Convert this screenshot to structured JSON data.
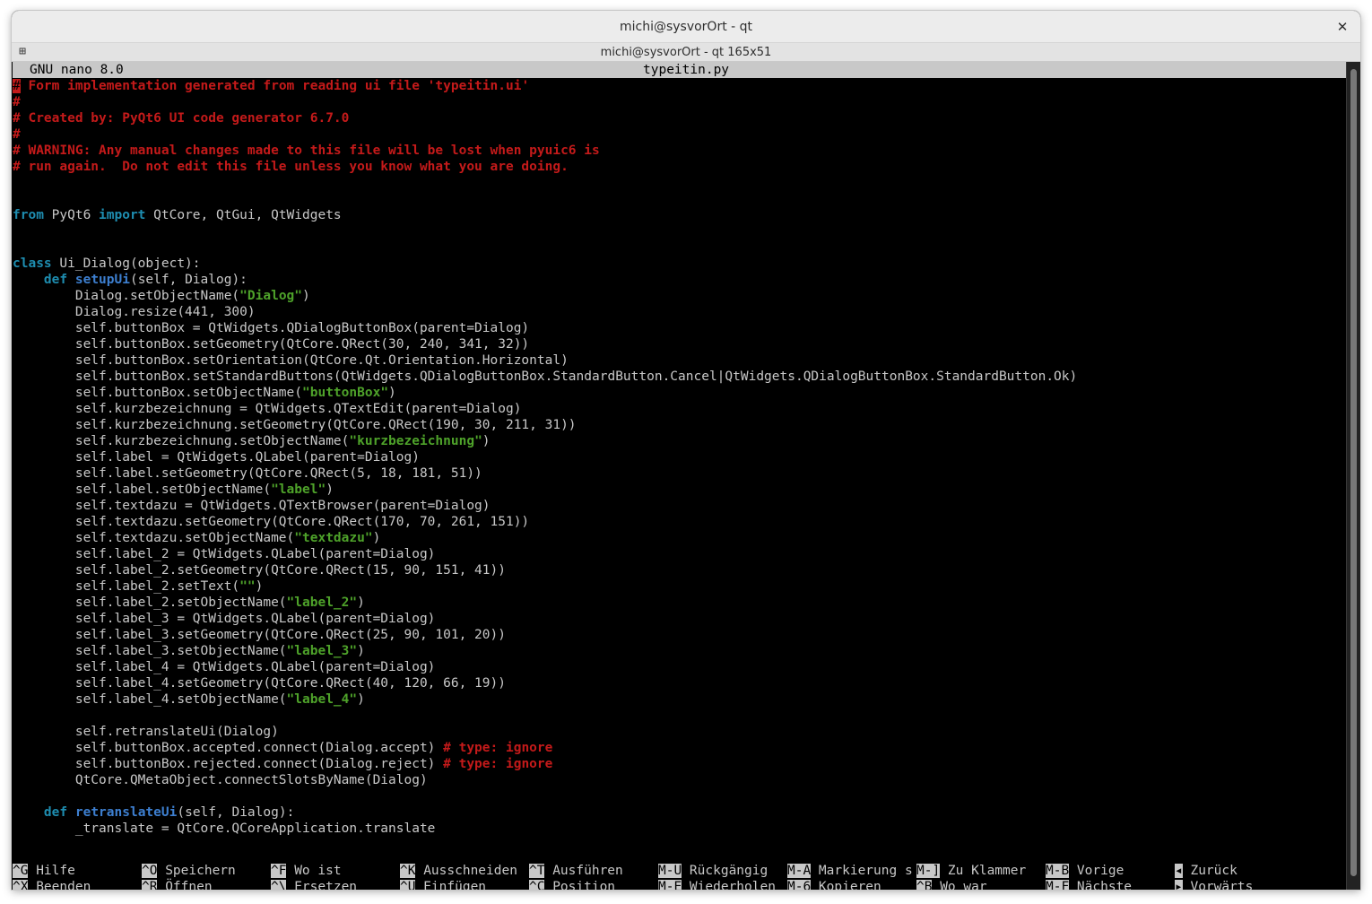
{
  "window": {
    "title": "michi@sysvorOrt - qt",
    "tab_title": "michi@sysvorOrt - qt 165x51",
    "close_glyph": "✕",
    "menu_glyph": "⊞"
  },
  "nano": {
    "version": "GNU nano 8.0",
    "filename": "typeitin.py"
  },
  "code_lines": [
    [
      {
        "t": "#",
        "c": "cursor"
      },
      {
        "t": " Form implementation generated from reading ui file 'typeitin.ui'",
        "c": "cm"
      }
    ],
    [
      {
        "t": "#",
        "c": "cm"
      }
    ],
    [
      {
        "t": "# Created by: PyQt6 UI code generator 6.7.0",
        "c": "cm"
      }
    ],
    [
      {
        "t": "#",
        "c": "cm"
      }
    ],
    [
      {
        "t": "# WARNING: Any manual changes made to this file will be lost when pyuic6 is",
        "c": "cm"
      }
    ],
    [
      {
        "t": "# run again.  Do not edit this file unless you know what you are doing.",
        "c": "cm"
      }
    ],
    [],
    [],
    [
      {
        "t": "from",
        "c": "kw"
      },
      {
        "t": " PyQt6 ",
        "c": "ident"
      },
      {
        "t": "import",
        "c": "kw"
      },
      {
        "t": " QtCore, QtGui, QtWidgets",
        "c": "ident"
      }
    ],
    [],
    [],
    [
      {
        "t": "class",
        "c": "kw"
      },
      {
        "t": " Ui_Dialog(object):",
        "c": "ident"
      }
    ],
    [
      {
        "t": "    ",
        "c": "ident"
      },
      {
        "t": "def",
        "c": "kw"
      },
      {
        "t": " ",
        "c": "ident"
      },
      {
        "t": "setupUi",
        "c": "fn"
      },
      {
        "t": "(self, Dialog):",
        "c": "ident"
      }
    ],
    [
      {
        "t": "        Dialog.setObjectName(",
        "c": "ident"
      },
      {
        "t": "\"Dialog\"",
        "c": "st"
      },
      {
        "t": ")",
        "c": "ident"
      }
    ],
    [
      {
        "t": "        Dialog.resize(441, 300)",
        "c": "ident"
      }
    ],
    [
      {
        "t": "        self.buttonBox = QtWidgets.QDialogButtonBox(parent=Dialog)",
        "c": "ident"
      }
    ],
    [
      {
        "t": "        self.buttonBox.setGeometry(QtCore.QRect(30, 240, 341, 32))",
        "c": "ident"
      }
    ],
    [
      {
        "t": "        self.buttonBox.setOrientation(QtCore.Qt.Orientation.Horizontal)",
        "c": "ident"
      }
    ],
    [
      {
        "t": "        self.buttonBox.setStandardButtons(QtWidgets.QDialogButtonBox.StandardButton.Cancel|QtWidgets.QDialogButtonBox.StandardButton.Ok)",
        "c": "ident"
      }
    ],
    [
      {
        "t": "        self.buttonBox.setObjectName(",
        "c": "ident"
      },
      {
        "t": "\"buttonBox\"",
        "c": "st"
      },
      {
        "t": ")",
        "c": "ident"
      }
    ],
    [
      {
        "t": "        self.kurzbezeichnung = QtWidgets.QTextEdit(parent=Dialog)",
        "c": "ident"
      }
    ],
    [
      {
        "t": "        self.kurzbezeichnung.setGeometry(QtCore.QRect(190, 30, 211, 31))",
        "c": "ident"
      }
    ],
    [
      {
        "t": "        self.kurzbezeichnung.setObjectName(",
        "c": "ident"
      },
      {
        "t": "\"kurzbezeichnung\"",
        "c": "st"
      },
      {
        "t": ")",
        "c": "ident"
      }
    ],
    [
      {
        "t": "        self.label = QtWidgets.QLabel(parent=Dialog)",
        "c": "ident"
      }
    ],
    [
      {
        "t": "        self.label.setGeometry(QtCore.QRect(5, 18, 181, 51))",
        "c": "ident"
      }
    ],
    [
      {
        "t": "        self.label.setObjectName(",
        "c": "ident"
      },
      {
        "t": "\"label\"",
        "c": "st"
      },
      {
        "t": ")",
        "c": "ident"
      }
    ],
    [
      {
        "t": "        self.textdazu = QtWidgets.QTextBrowser(parent=Dialog)",
        "c": "ident"
      }
    ],
    [
      {
        "t": "        self.textdazu.setGeometry(QtCore.QRect(170, 70, 261, 151))",
        "c": "ident"
      }
    ],
    [
      {
        "t": "        self.textdazu.setObjectName(",
        "c": "ident"
      },
      {
        "t": "\"textdazu\"",
        "c": "st"
      },
      {
        "t": ")",
        "c": "ident"
      }
    ],
    [
      {
        "t": "        self.label_2 = QtWidgets.QLabel(parent=Dialog)",
        "c": "ident"
      }
    ],
    [
      {
        "t": "        self.label_2.setGeometry(QtCore.QRect(15, 90, 151, 41))",
        "c": "ident"
      }
    ],
    [
      {
        "t": "        self.label_2.setText(",
        "c": "ident"
      },
      {
        "t": "\"\"",
        "c": "st"
      },
      {
        "t": ")",
        "c": "ident"
      }
    ],
    [
      {
        "t": "        self.label_2.setObjectName(",
        "c": "ident"
      },
      {
        "t": "\"label_2\"",
        "c": "st"
      },
      {
        "t": ")",
        "c": "ident"
      }
    ],
    [
      {
        "t": "        self.label_3 = QtWidgets.QLabel(parent=Dialog)",
        "c": "ident"
      }
    ],
    [
      {
        "t": "        self.label_3.setGeometry(QtCore.QRect(25, 90, 101, 20))",
        "c": "ident"
      }
    ],
    [
      {
        "t": "        self.label_3.setObjectName(",
        "c": "ident"
      },
      {
        "t": "\"label_3\"",
        "c": "st"
      },
      {
        "t": ")",
        "c": "ident"
      }
    ],
    [
      {
        "t": "        self.label_4 = QtWidgets.QLabel(parent=Dialog)",
        "c": "ident"
      }
    ],
    [
      {
        "t": "        self.label_4.setGeometry(QtCore.QRect(40, 120, 66, 19))",
        "c": "ident"
      }
    ],
    [
      {
        "t": "        self.label_4.setObjectName(",
        "c": "ident"
      },
      {
        "t": "\"label_4\"",
        "c": "st"
      },
      {
        "t": ")",
        "c": "ident"
      }
    ],
    [],
    [
      {
        "t": "        self.retranslateUi(Dialog)",
        "c": "ident"
      }
    ],
    [
      {
        "t": "        self.buttonBox.accepted.connect(Dialog.accept) ",
        "c": "ident"
      },
      {
        "t": "# type: ignore",
        "c": "cm"
      }
    ],
    [
      {
        "t": "        self.buttonBox.rejected.connect(Dialog.reject) ",
        "c": "ident"
      },
      {
        "t": "# type: ignore",
        "c": "cm"
      }
    ],
    [
      {
        "t": "        QtCore.QMetaObject.connectSlotsByName(Dialog)",
        "c": "ident"
      }
    ],
    [],
    [
      {
        "t": "    ",
        "c": "ident"
      },
      {
        "t": "def",
        "c": "kw"
      },
      {
        "t": " ",
        "c": "ident"
      },
      {
        "t": "retranslateUi",
        "c": "fn"
      },
      {
        "t": "(self, Dialog):",
        "c": "ident"
      }
    ],
    [
      {
        "t": "        _translate = QtCore.QCoreApplication.translate",
        "c": "ident"
      }
    ]
  ],
  "shortcuts": [
    [
      {
        "key": "^G",
        "label": " Hilfe"
      },
      {
        "key": "^O",
        "label": " Speichern"
      },
      {
        "key": "^F",
        "label": " Wo ist"
      },
      {
        "key": "^K",
        "label": " Ausschneiden"
      },
      {
        "key": "^T",
        "label": " Ausführen"
      },
      {
        "key": "M-U",
        "label": " Rückgängig"
      },
      {
        "key": "M-A",
        "label": " Markierung s"
      },
      {
        "key": "M-]",
        "label": " Zu Klammer"
      },
      {
        "key": "M-B",
        "label": " Vorige"
      },
      {
        "key": "◂",
        "label": " Zurück"
      }
    ],
    [
      {
        "key": "^X",
        "label": " Beenden"
      },
      {
        "key": "^R",
        "label": " Öffnen"
      },
      {
        "key": "^\\",
        "label": " Ersetzen"
      },
      {
        "key": "^U",
        "label": " Einfügen"
      },
      {
        "key": "^C",
        "label": " Position"
      },
      {
        "key": "M-E",
        "label": " Wiederholen"
      },
      {
        "key": "M-6",
        "label": " Kopieren"
      },
      {
        "key": "^B",
        "label": " Wo war"
      },
      {
        "key": "M-F",
        "label": " Nächste"
      },
      {
        "key": "▸",
        "label": " Vorwärts"
      }
    ]
  ]
}
